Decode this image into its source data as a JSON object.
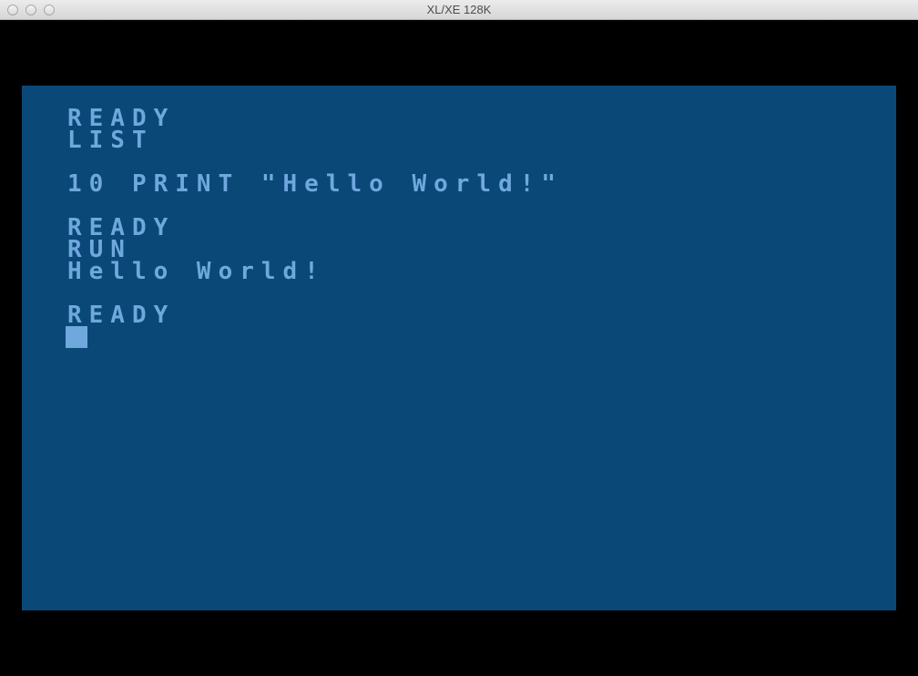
{
  "window": {
    "title": "XL/XE 128K"
  },
  "screen": {
    "background": "#0a4878",
    "text_color": "#6fa8dc",
    "lines": [
      "READY",
      "LIST",
      "",
      "10 PRINT \"Hello World!\"",
      "",
      "READY",
      "RUN",
      "Hello World!",
      "",
      "READY"
    ]
  }
}
